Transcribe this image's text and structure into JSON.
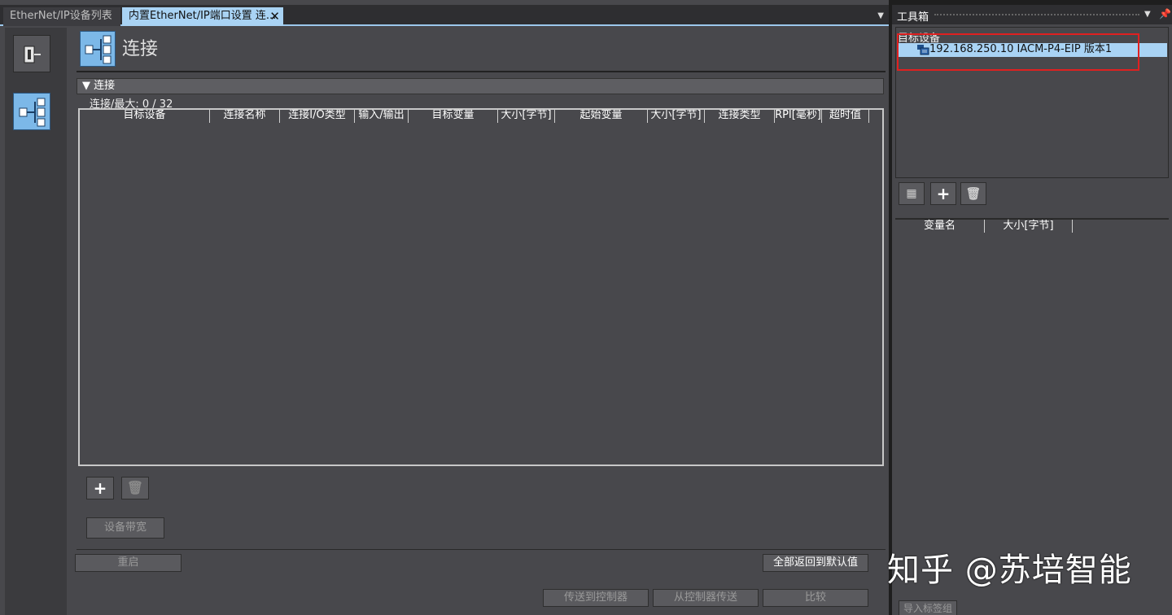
{
  "tabs": [
    {
      "label": "EtherNet/IP设备列表"
    },
    {
      "label": "内置EtherNet/IP端口设置 连..."
    }
  ],
  "header": {
    "title": "连接"
  },
  "section": {
    "title": "连接",
    "count_label": "连接/最大: 0 / 32",
    "columns": [
      "目标设备",
      "连接名称",
      "连接I/O类型",
      "输入/输出",
      "目标变量",
      "大小[字节]",
      "起始变量",
      "大小[字节]",
      "连接类型",
      "RPI[毫秒]",
      "超时值"
    ]
  },
  "buttons": {
    "bandwidth": "设备带宽",
    "restart": "重启",
    "reset_defaults": "全部返回到默认值",
    "transfer_to": "传送到控制器",
    "transfer_from": "从控制器传送",
    "compare": "比较"
  },
  "toolbox": {
    "title": "工具箱",
    "target_label": "目标设备",
    "device": "192.168.250.10   IACM-P4-EIP   版本1",
    "var_columns": [
      "变量名",
      "大小[字节]"
    ],
    "import_button": "导入标签组"
  },
  "watermark": "知乎 @苏培智能",
  "colors": {
    "accent": "#a9d3f4",
    "highlight": "#e02020",
    "panel": "#48484c"
  },
  "icons": [
    "close-icon",
    "dropdown-icon",
    "pin-icon",
    "add-icon",
    "delete-icon",
    "folder-icon",
    "device-icon",
    "connection-icon"
  ]
}
